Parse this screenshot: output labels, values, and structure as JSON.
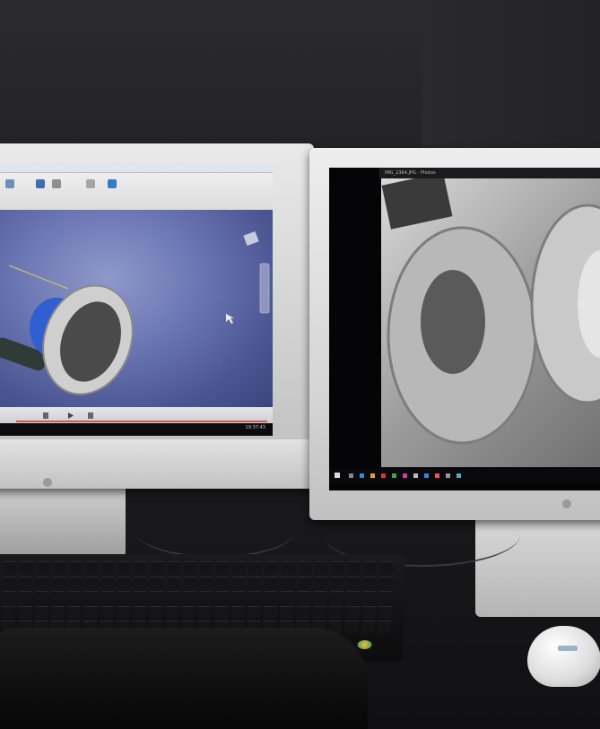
{
  "scene": {
    "description_type": "photo",
    "left_monitor": {
      "app": "3D CAD modeling software",
      "taskbar_time": "19:37:43"
    },
    "right_monitor": {
      "app": "Photos",
      "window_title": "IMG_2364.JPG - Photos"
    }
  },
  "colors": {
    "cad_background": "#6a76b3",
    "part_blue": "#2f5fd0",
    "metal": "#c8c8c8",
    "monitor_bezel": "#d9d9d9"
  }
}
